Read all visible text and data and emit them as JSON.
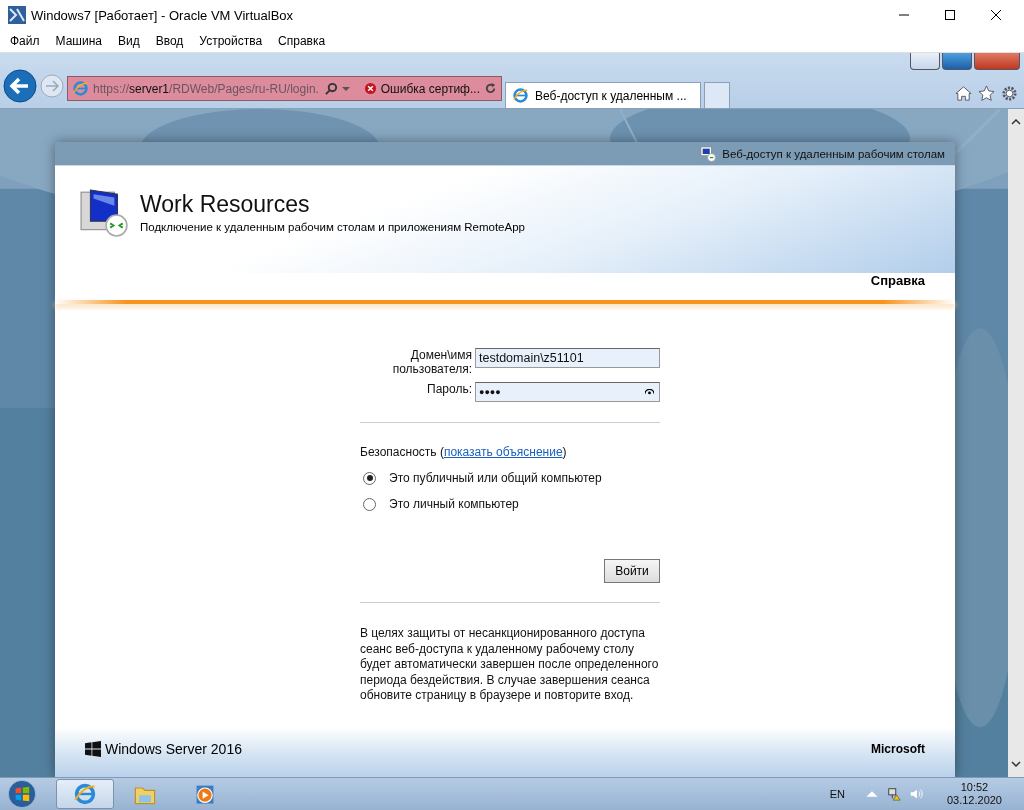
{
  "vm_window": {
    "title": "Windows7 [Работает] - Oracle VM VirtualBox",
    "menu": [
      "Файл",
      "Машина",
      "Вид",
      "Ввод",
      "Устройства",
      "Справка"
    ]
  },
  "browser": {
    "address": {
      "scheme": "https://",
      "host": "server1",
      "path": "/RDWeb/Pages/ru-RU/login.",
      "cert_error": "Ошибка сертиф..."
    },
    "tabs": [
      {
        "label": "Веб-доступ к удаленным ...",
        "selected": true
      }
    ]
  },
  "page": {
    "header_link": "Веб-доступ к удаленным рабочим столам",
    "title": "Work Resources",
    "subtitle": "Подключение к удаленным рабочим столам и приложениям RemoteApp",
    "help": "Справка",
    "fields": [
      {
        "kind": "text",
        "label": "Домен\\имя пользователя:",
        "value": "testdomain\\z51101"
      },
      {
        "kind": "password",
        "label": "Пароль:",
        "value": "●●●●"
      }
    ],
    "security": {
      "prefix": "Безопасность (",
      "link": "показать объяснение",
      "suffix": ")"
    },
    "options": [
      {
        "label": "Это публичный или общий компьютер",
        "selected": true
      },
      {
        "label": "Это личный компьютер",
        "selected": false
      }
    ],
    "submit": "Войти",
    "notice": "В целях защиты от несанкционированного доступа сеанс веб-доступа к удаленному рабочему столу будет автоматически завершен после определенного периода бездействия. В случае завершения сеанса обновите страницу в браузере и повторите вход.",
    "footer_product": "Windows Server 2016",
    "footer_brand": "Microsoft"
  },
  "taskbar": {
    "language": "EN",
    "time": "10:52",
    "date": "03.12.2020"
  }
}
